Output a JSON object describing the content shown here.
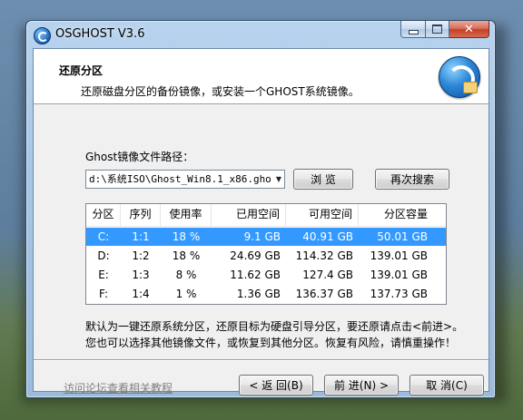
{
  "window": {
    "title": "OSGHOST V3.6",
    "close_glyph": "✕"
  },
  "header": {
    "title": "还原分区",
    "subtitle": "还原磁盘分区的备份镜像，或安装一个GHOST系统镜像。",
    "logo_icon": "restore-arrows-icon"
  },
  "path": {
    "label": "Ghost镜像文件路径：",
    "value": "d:\\系统ISO\\Ghost_Win8.1_x86.gho",
    "dropdown_glyph": "▼",
    "browse_label": "浏 览",
    "search_label": "再次搜索"
  },
  "table": {
    "columns": [
      "分区",
      "序列",
      "使用率",
      "已用空间",
      "可用空间",
      "分区容量"
    ],
    "rows": [
      [
        "C:",
        "1:1",
        "18 %",
        "9.1 GB",
        "40.91 GB",
        "50.01 GB"
      ],
      [
        "D:",
        "1:2",
        "18 %",
        "24.69 GB",
        "114.32 GB",
        "139.01 GB"
      ],
      [
        "E:",
        "1:3",
        "8 %",
        "11.62 GB",
        "127.4 GB",
        "139.01 GB"
      ],
      [
        "F:",
        "1:4",
        "1 %",
        "1.36 GB",
        "136.37 GB",
        "137.73 GB"
      ]
    ],
    "selected_row": 0
  },
  "notice": {
    "line1": "默认为一键还原系统分区，还原目标为硬盘引导分区，要还原请点击<前进>。",
    "line2": "您也可以选择其他镜像文件，或恢复到其他分区。恢复有风险，请慎重操作！"
  },
  "footer": {
    "help_link": "访问论坛查看相关教程",
    "back_label": "< 返 回(B)",
    "next_label": "前 进(N) >",
    "cancel_label": "取 消(C)"
  },
  "colors": {
    "selection": "#3399ff",
    "title_gradient": "#a7c6e6"
  }
}
